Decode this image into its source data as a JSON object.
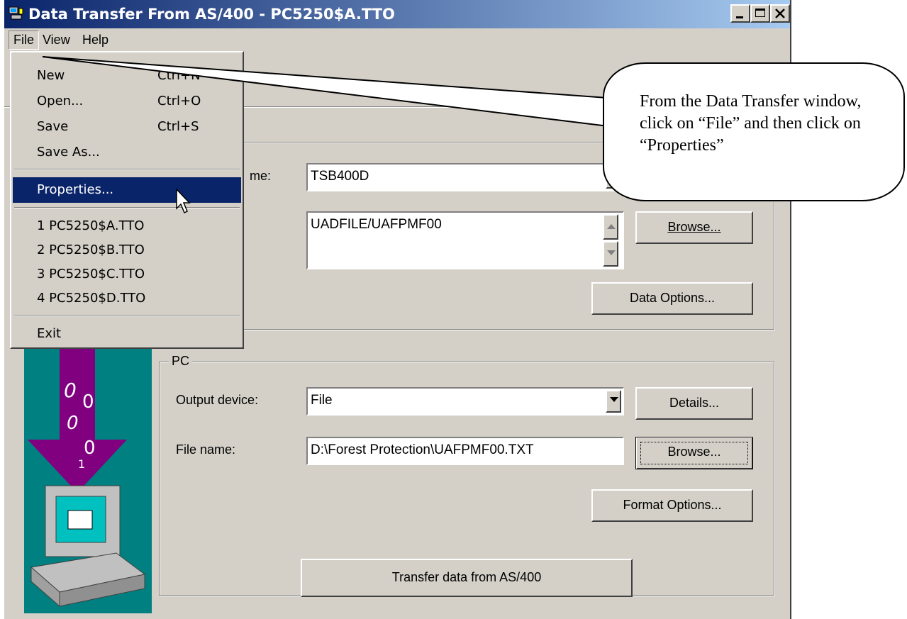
{
  "window": {
    "title": "Data Transfer From AS/400 - PC5250$A.TTO",
    "controls": [
      "minimize",
      "maximize",
      "close"
    ]
  },
  "menubar": {
    "items": [
      "File",
      "View",
      "Help"
    ]
  },
  "file_menu": {
    "items": [
      {
        "label": "New",
        "shortcut": "Ctrl+N"
      },
      {
        "label": "Open...",
        "shortcut": "Ctrl+O"
      },
      {
        "label": "Save",
        "shortcut": "Ctrl+S"
      },
      {
        "label": "Save As...",
        "shortcut": ""
      },
      {
        "label": "Properties...",
        "shortcut": "",
        "selected": true
      },
      {
        "label": "1 PC5250$A.TTO",
        "shortcut": ""
      },
      {
        "label": "2 PC5250$B.TTO",
        "shortcut": ""
      },
      {
        "label": "3 PC5250$C.TTO",
        "shortcut": ""
      },
      {
        "label": "4 PC5250$D.TTO",
        "shortcut": ""
      },
      {
        "label": "Exit",
        "shortcut": ""
      }
    ]
  },
  "as400": {
    "system_label_partial": "me:",
    "system_name": "TSB400D",
    "file_name": "UADFILE/UAFPMF00",
    "browse": "Browse...",
    "data_options": "Data Options..."
  },
  "pc": {
    "group_title": "PC",
    "output_device_label": "Output device:",
    "output_device": "File",
    "details": "Details...",
    "file_name_label": "File name:",
    "file_name": "D:\\Forest Protection\\UAFPMF00.TXT",
    "browse": "Browse...",
    "format_options": "Format Options..."
  },
  "transfer_button": "Transfer data from AS/400",
  "callout": {
    "text": "From the Data Transfer window, click on “File” and then click on “Properties”"
  },
  "colors": {
    "titlebar": "#0a246a",
    "selection": "#0a246a",
    "panel": "#008080",
    "arrow": "#800080"
  }
}
